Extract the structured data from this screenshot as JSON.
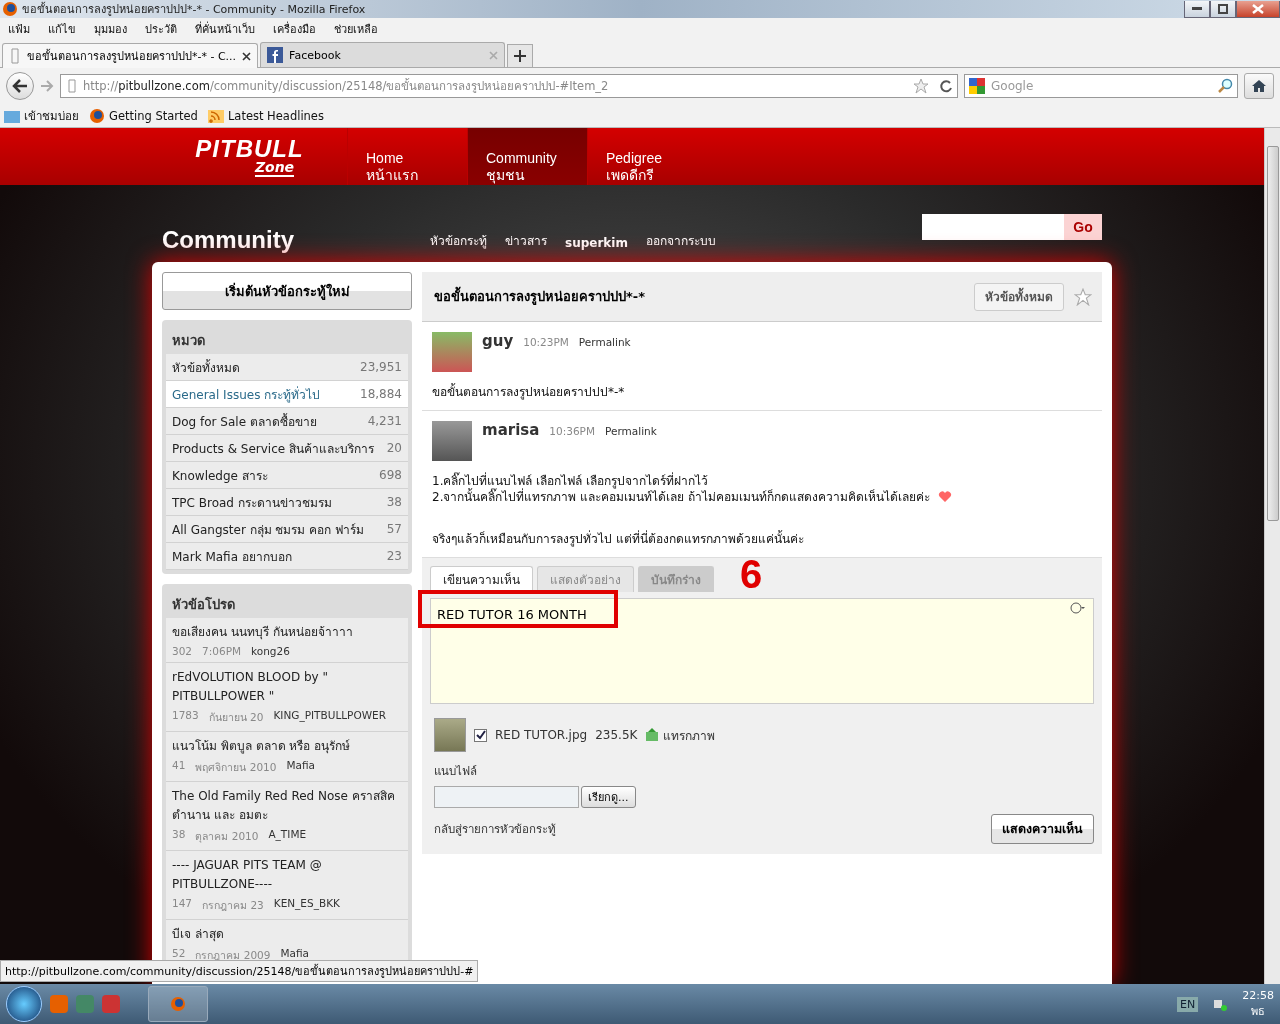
{
  "window": {
    "title": "ขอขั้นตอนการลงรูปหน่อยคราปปป*-* - Community - Mozilla Firefox"
  },
  "menu": [
    "แฟ้ม",
    "แก้ไข",
    "มุมมอง",
    "ประวัติ",
    "ที่คั่นหน้าเว็บ",
    "เครื่องมือ",
    "ช่วยเหลือ"
  ],
  "tabs": [
    {
      "label": "ขอขั้นตอนการลงรูปหน่อยคราปปป*-* - C...",
      "selected": true,
      "kind": "page"
    },
    {
      "label": "Facebook",
      "selected": false,
      "kind": "facebook"
    }
  ],
  "address": {
    "scheme": "http://",
    "host": "pitbullzone.com",
    "path": "/community/discussion/25148/ขอขั้นตอนการลงรูปหน่อยคราปปป-#Item_2"
  },
  "search": {
    "placeholder": "Google"
  },
  "bookmarks": [
    {
      "label": "เข้าชมบ่อย",
      "kind": "folder"
    },
    {
      "label": "Getting Started",
      "kind": "firefox"
    },
    {
      "label": "Latest Headlines",
      "kind": "feed"
    }
  ],
  "site": {
    "logo": {
      "line1": "PITBULL",
      "line2": "Zone"
    },
    "nav": [
      {
        "en": "Home",
        "th": "หน้าแรก",
        "selected": false
      },
      {
        "en": "Community",
        "th": "ชุมชน",
        "selected": true
      },
      {
        "en": "Pedigree",
        "th": "เพดดีกรี",
        "selected": false
      }
    ],
    "heading": "Community",
    "links": [
      {
        "label": "หัวข้อกระทู้",
        "kind": "link"
      },
      {
        "label": "ข่าวสาร",
        "kind": "link"
      },
      {
        "label": "superkim",
        "kind": "user"
      },
      {
        "label": "ออกจากระบบ",
        "kind": "link"
      }
    ],
    "search_button": "Go"
  },
  "sidebar": {
    "new_topic": "เริ่มต้นหัวข้อกระทู้ใหม่",
    "categories_title": "หมวด",
    "categories": [
      {
        "label": "หัวข้อทั้งหมด",
        "count": "23,951",
        "selected": false
      },
      {
        "label": "General Issues กระทู้ทั่วไป",
        "count": "18,884",
        "selected": true
      },
      {
        "label": "Dog for Sale ตลาดซื้อขาย",
        "count": "4,231",
        "selected": false
      },
      {
        "label": "Products & Service สินค้าและบริการ",
        "count": "20",
        "selected": false
      },
      {
        "label": "Knowledge สาระ",
        "count": "698",
        "selected": false
      },
      {
        "label": "TPC Broad กระดานข่าวชมรม",
        "count": "38",
        "selected": false
      },
      {
        "label": "All Gangster กลุ่ม ชมรม คอก ฟาร์ม",
        "count": "57",
        "selected": false
      },
      {
        "label": "Mark Mafia อยากบอก",
        "count": "23",
        "selected": false
      }
    ],
    "favorites_title": "หัวข้อโปรด",
    "favorites": [
      {
        "title": "ขอเสียงคน นนทบุรี กันหน่อยจ้าาาา",
        "count": "302",
        "date": "7:06PM",
        "author": "kong26"
      },
      {
        "title": "rEdVOLUTION BLOOD by \" PITBULLPOWER \"",
        "count": "1783",
        "date": "กันยายน 20",
        "author": "KING_PITBULLPOWER"
      },
      {
        "title": "แนวโน้ม พิตบูล ตลาด หรือ อนุรักษ์",
        "count": "41",
        "date": "พฤศจิกายน 2010",
        "author": "Mafia"
      },
      {
        "title": "The Old Family Red Red Nose คราสสิค ตำนาน และ อมตะ",
        "count": "38",
        "date": "ตุลาคม 2010",
        "author": "A_TIME"
      },
      {
        "title": "---- JAGUAR PITS TEAM @ PITBULLZONE----",
        "count": "147",
        "date": "กรกฎาคม 23",
        "author": "KEN_ES_BKK"
      },
      {
        "title": "บีเจ ล่าสุด",
        "count": "52",
        "date": "กรกฎาคม 2009",
        "author": "Mafia"
      }
    ]
  },
  "thread": {
    "title": "ขอขั้นตอนการลงรูปหน่อยคราปปป*-*",
    "all_button": "หัวข้อทั้งหมด",
    "bookmarked": false,
    "posts": [
      {
        "author": "guy",
        "time": "10:23PM",
        "permalink": "Permalink",
        "paragraphs": [
          {
            "text": "ขอขั้นตอนการลงรูปหน่อยคราปปป*-*",
            "emoticon": false
          }
        ]
      },
      {
        "author": "marisa",
        "time": "10:36PM",
        "permalink": "Permalink",
        "paragraphs": [
          {
            "text": "1.คลิ๊กไปที่แนบไฟล์ เลือกไฟล์ เลือกรูปจากไดร์ที่ฝากไว้",
            "emoticon": false
          },
          {
            "text": "2.จากนั้นคลิ๊กไปที่แทรกภาพ และคอมเมนท์ได้เลย ถ้าไม่คอมเมนท์ก็กดแสดงความคิดเห็นได้เลยค่ะ",
            "emoticon": true
          },
          {
            "text": "จริงๆแล้วก็เหมือนกับการลงรูปทั่วไป แต่ที่นี่ต้องกดแทรกภาพด้วยแค่นั้นค่ะ",
            "emoticon": false
          }
        ]
      }
    ]
  },
  "editor": {
    "tabs": [
      {
        "label": "เขียนความเห็น",
        "selected": true,
        "kind": "tab"
      },
      {
        "label": "แสดงตัวอย่าง",
        "selected": false,
        "kind": "tab"
      },
      {
        "label": "บันทึกร่าง",
        "selected": false,
        "kind": "button"
      }
    ],
    "value": "RED TUTOR 16 MONTH",
    "annotation": "6",
    "attachment": {
      "checked": true,
      "file": "RED TUTOR.jpg",
      "size": "235.5K",
      "insert": "แทรกภาพ"
    },
    "attach_label": "แนบไฟล์",
    "browse": "เรียกดู...",
    "back_link": "กลับสู่รายการหัวข้อกระทู้",
    "submit": "แสดงความเห็น"
  },
  "status_bar": "http://pitbullzone.com/community/discussion/25148/ขอขั้นตอนการลงรูปหน่อยคราปปป-#",
  "taskbar": {
    "language": "EN",
    "time": "22:58",
    "day": "พธ"
  }
}
